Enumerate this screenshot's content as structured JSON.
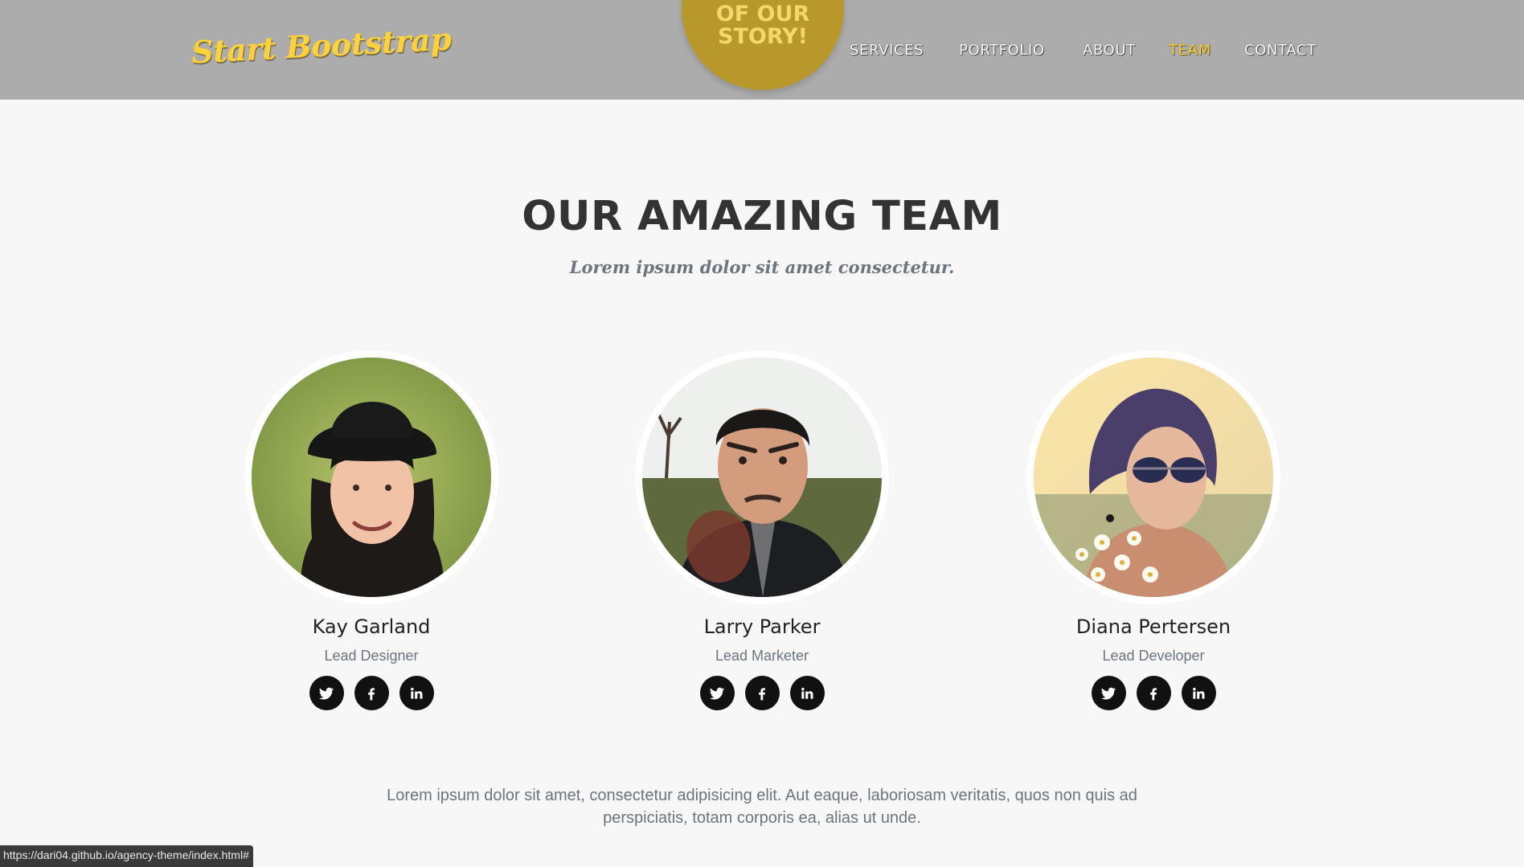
{
  "navbar": {
    "brand": "Start Bootstrap",
    "badge_lines": [
      "OF OUR",
      "STORY!"
    ],
    "items": [
      {
        "label": "SERVICES",
        "active": false
      },
      {
        "label": "PORTFOLIO",
        "active": false
      },
      {
        "label": "ABOUT",
        "active": false
      },
      {
        "label": "TEAM",
        "active": true
      },
      {
        "label": "CONTACT",
        "active": false
      }
    ]
  },
  "team": {
    "heading": "OUR AMAZING TEAM",
    "subheading": "Lorem ipsum dolor sit amet consectetur.",
    "members": [
      {
        "name": "Kay Garland",
        "role": "Lead Designer",
        "social": [
          "twitter-icon",
          "facebook-icon",
          "linkedin-icon"
        ]
      },
      {
        "name": "Larry Parker",
        "role": "Lead Marketer",
        "social": [
          "twitter-icon",
          "facebook-icon",
          "linkedin-icon"
        ]
      },
      {
        "name": "Diana Pertersen",
        "role": "Lead Developer",
        "social": [
          "twitter-icon",
          "facebook-icon",
          "linkedin-icon"
        ]
      }
    ],
    "footer": "Lorem ipsum dolor sit amet, consectetur adipisicing elit. Aut eaque, laboriosam veritatis, quos non quis ad perspiciatis, totam corporis ea, alias ut unde."
  },
  "status_bar": {
    "url": "https://dari04.github.io/agency-theme/index.html#"
  },
  "colors": {
    "navbar_bg": "#acacac",
    "accent": "#fed136",
    "badge": "#b8972b",
    "page_bg": "#f7f7f7",
    "heading": "#333333",
    "muted": "#6c757d"
  }
}
